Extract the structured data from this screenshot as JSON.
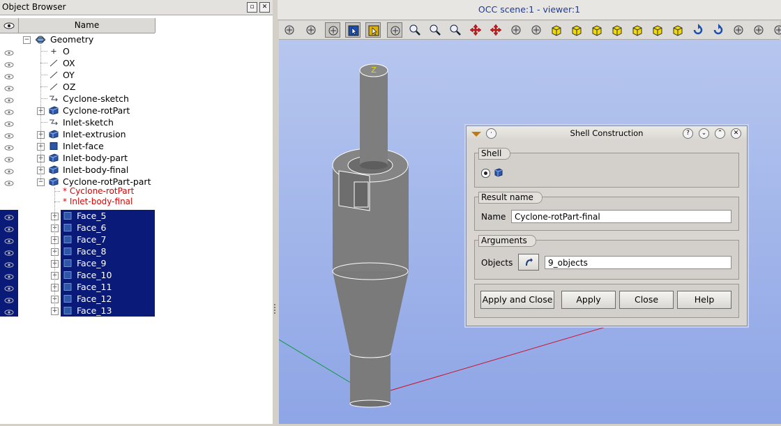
{
  "object_browser": {
    "title": "Object Browser",
    "column_name": "Name",
    "root": "Geometry",
    "items": [
      {
        "label": "O",
        "icon": "point-icon"
      },
      {
        "label": "OX",
        "icon": "line-icon"
      },
      {
        "label": "OY",
        "icon": "line-icon"
      },
      {
        "label": "OZ",
        "icon": "line-icon"
      },
      {
        "label": "Cyclone-sketch",
        "icon": "sketch-icon"
      },
      {
        "label": "Cyclone-rotPart",
        "icon": "solid-icon"
      },
      {
        "label": "Inlet-sketch",
        "icon": "sketch-icon"
      },
      {
        "label": "Inlet-extrusion",
        "icon": "solid-icon"
      },
      {
        "label": "Inlet-face",
        "icon": "face-icon"
      },
      {
        "label": "Inlet-body-part",
        "icon": "solid-icon"
      },
      {
        "label": "Inlet-body-final",
        "icon": "solid-icon"
      },
      {
        "label": "Cyclone-rotPart-part",
        "icon": "solid-icon"
      }
    ],
    "references": [
      "* Cyclone-rotPart",
      "* Inlet-body-final"
    ],
    "faces": [
      "Face_5",
      "Face_6",
      "Face_7",
      "Face_8",
      "Face_9",
      "Face_10",
      "Face_11",
      "Face_12",
      "Face_13"
    ]
  },
  "viewer": {
    "title": "OCC scene:1 - viewer:1",
    "axis_label": "Z",
    "colors": {
      "x_axis": "#d0102a",
      "y_axis": "#0a9a3a",
      "z_axis": "#e0e000",
      "background_top": "#b6c6ee",
      "background_bottom": "#8ea5e6",
      "model": "#7a7a7a"
    }
  },
  "dialog": {
    "title": "Shell Construction",
    "group_shell": "Shell",
    "group_result": "Result name",
    "name_label": "Name",
    "name_value": "Cyclone-rotPart-final",
    "group_arguments": "Arguments",
    "objects_label": "Objects",
    "objects_value": "9_objects",
    "buttons": {
      "apply_close": "Apply and Close",
      "apply": "Apply",
      "close": "Close",
      "help": "Help"
    },
    "title_buttons": {
      "help": "?"
    }
  }
}
